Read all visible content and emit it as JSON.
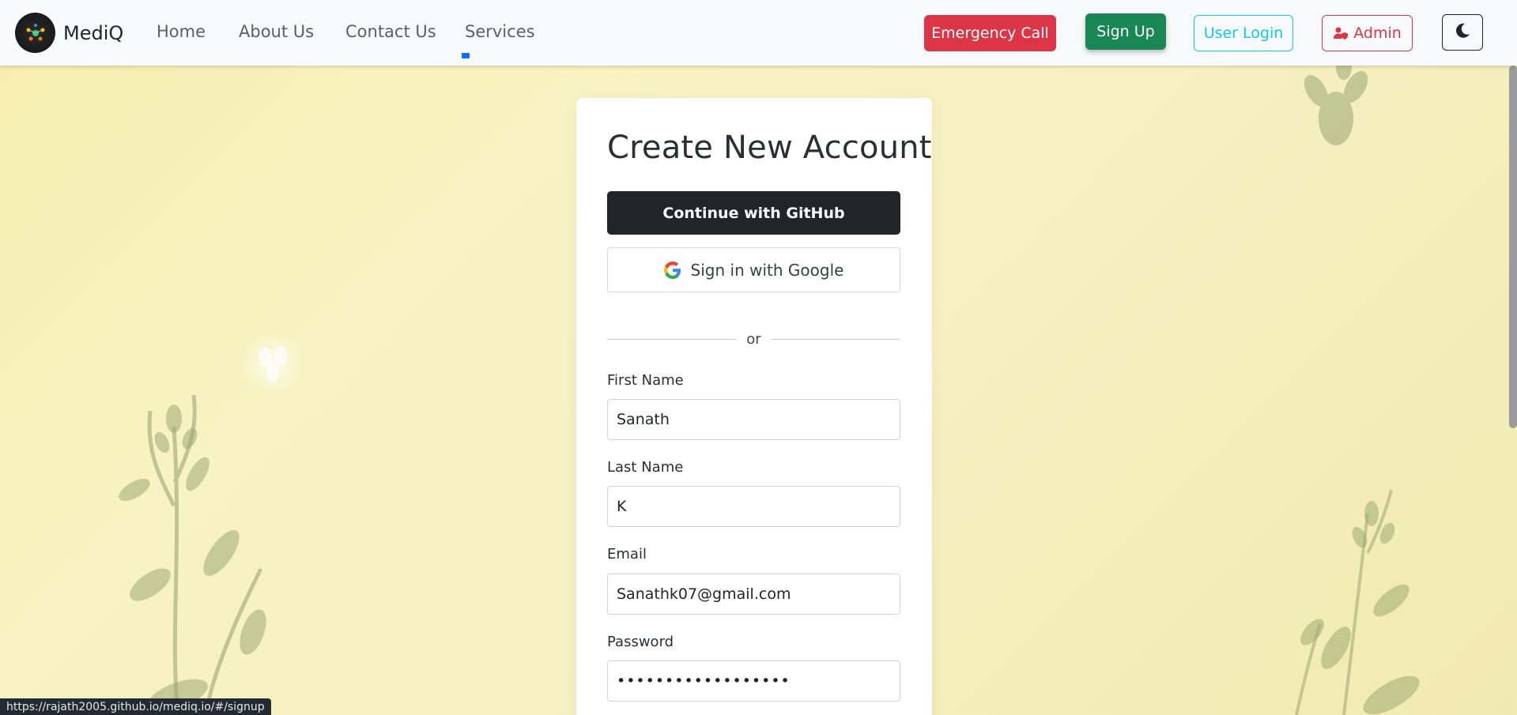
{
  "navbar": {
    "brand": "MediQ",
    "logo_icon": "mediq-logo-icon",
    "links": [
      "Home",
      "About Us",
      "Contact Us",
      "Services"
    ],
    "buttons": {
      "emergency": "Emergency Call",
      "signup": "Sign Up",
      "user_login": "User Login",
      "admin": "Admin",
      "theme_icon": "moon-icon"
    }
  },
  "card": {
    "title": "Create New Account",
    "github_button": "Continue with GitHub",
    "google_button": "Sign in with Google",
    "divider_text": "or",
    "fields": {
      "first_name": {
        "label": "First Name",
        "value": "Sanath"
      },
      "last_name": {
        "label": "Last Name",
        "value": "K"
      },
      "email": {
        "label": "Email",
        "value": "Sanathk07@gmail.com"
      },
      "password": {
        "label": "Password",
        "value": "••••••••••••••••••"
      }
    }
  },
  "status_url": "https://rajath2005.github.io/mediq.io/#/signup",
  "colors": {
    "emergency": "#dc3545",
    "signup": "#198754",
    "user_login": "#0dcaf0",
    "admin": "#dc3545",
    "github": "#212529"
  }
}
